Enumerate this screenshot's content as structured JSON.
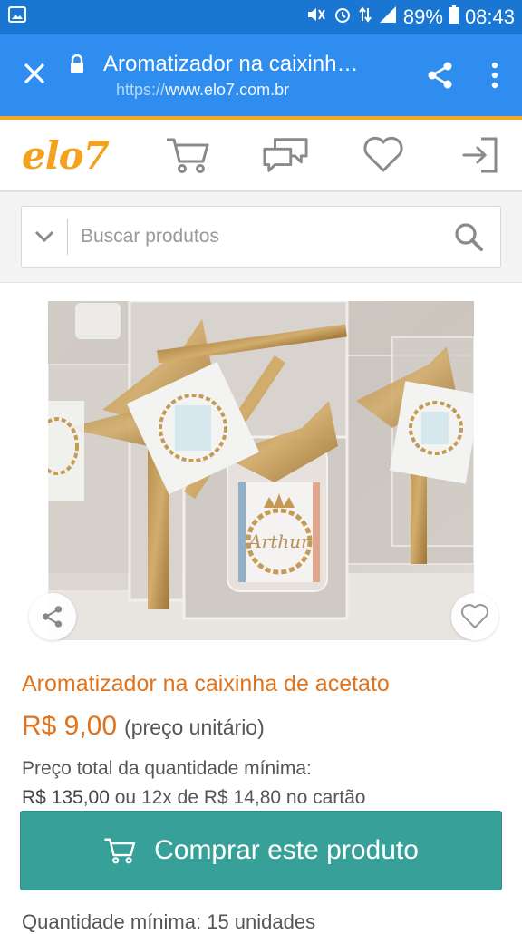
{
  "status_bar": {
    "battery": "89%",
    "time": "08:43"
  },
  "tab": {
    "title": "Aromatizador na caixinha de acetato",
    "url_scheme": "https://",
    "url_host": "www.elo7.com.br"
  },
  "site": {
    "logo": "elo7",
    "accent_color": "#f5a623",
    "brand_color": "#f4a11e"
  },
  "search": {
    "placeholder": "Buscar produtos"
  },
  "product": {
    "title": "Aromatizador na caixinha de acetato",
    "price": "R$ 9,00",
    "price_note": "(preço unitário)",
    "min_total_label": "Preço total da quantidade mínima:",
    "min_total": "R$ 135,00",
    "installments": " ou 12x de R$ 14,80 no cartão",
    "buy_label": "Comprar este produto",
    "min_quantity": "Quantidade mínima: 15 unidades",
    "image_tag_text": "Arthur"
  },
  "icons": {
    "close": "close-icon",
    "lock": "lock-icon",
    "share": "share-icon",
    "more": "more-vert-icon",
    "cart": "cart-icon",
    "messages": "messages-icon",
    "favorites": "heart-icon",
    "login": "login-icon",
    "dropdown": "chevron-down-icon",
    "search": "search-icon"
  }
}
